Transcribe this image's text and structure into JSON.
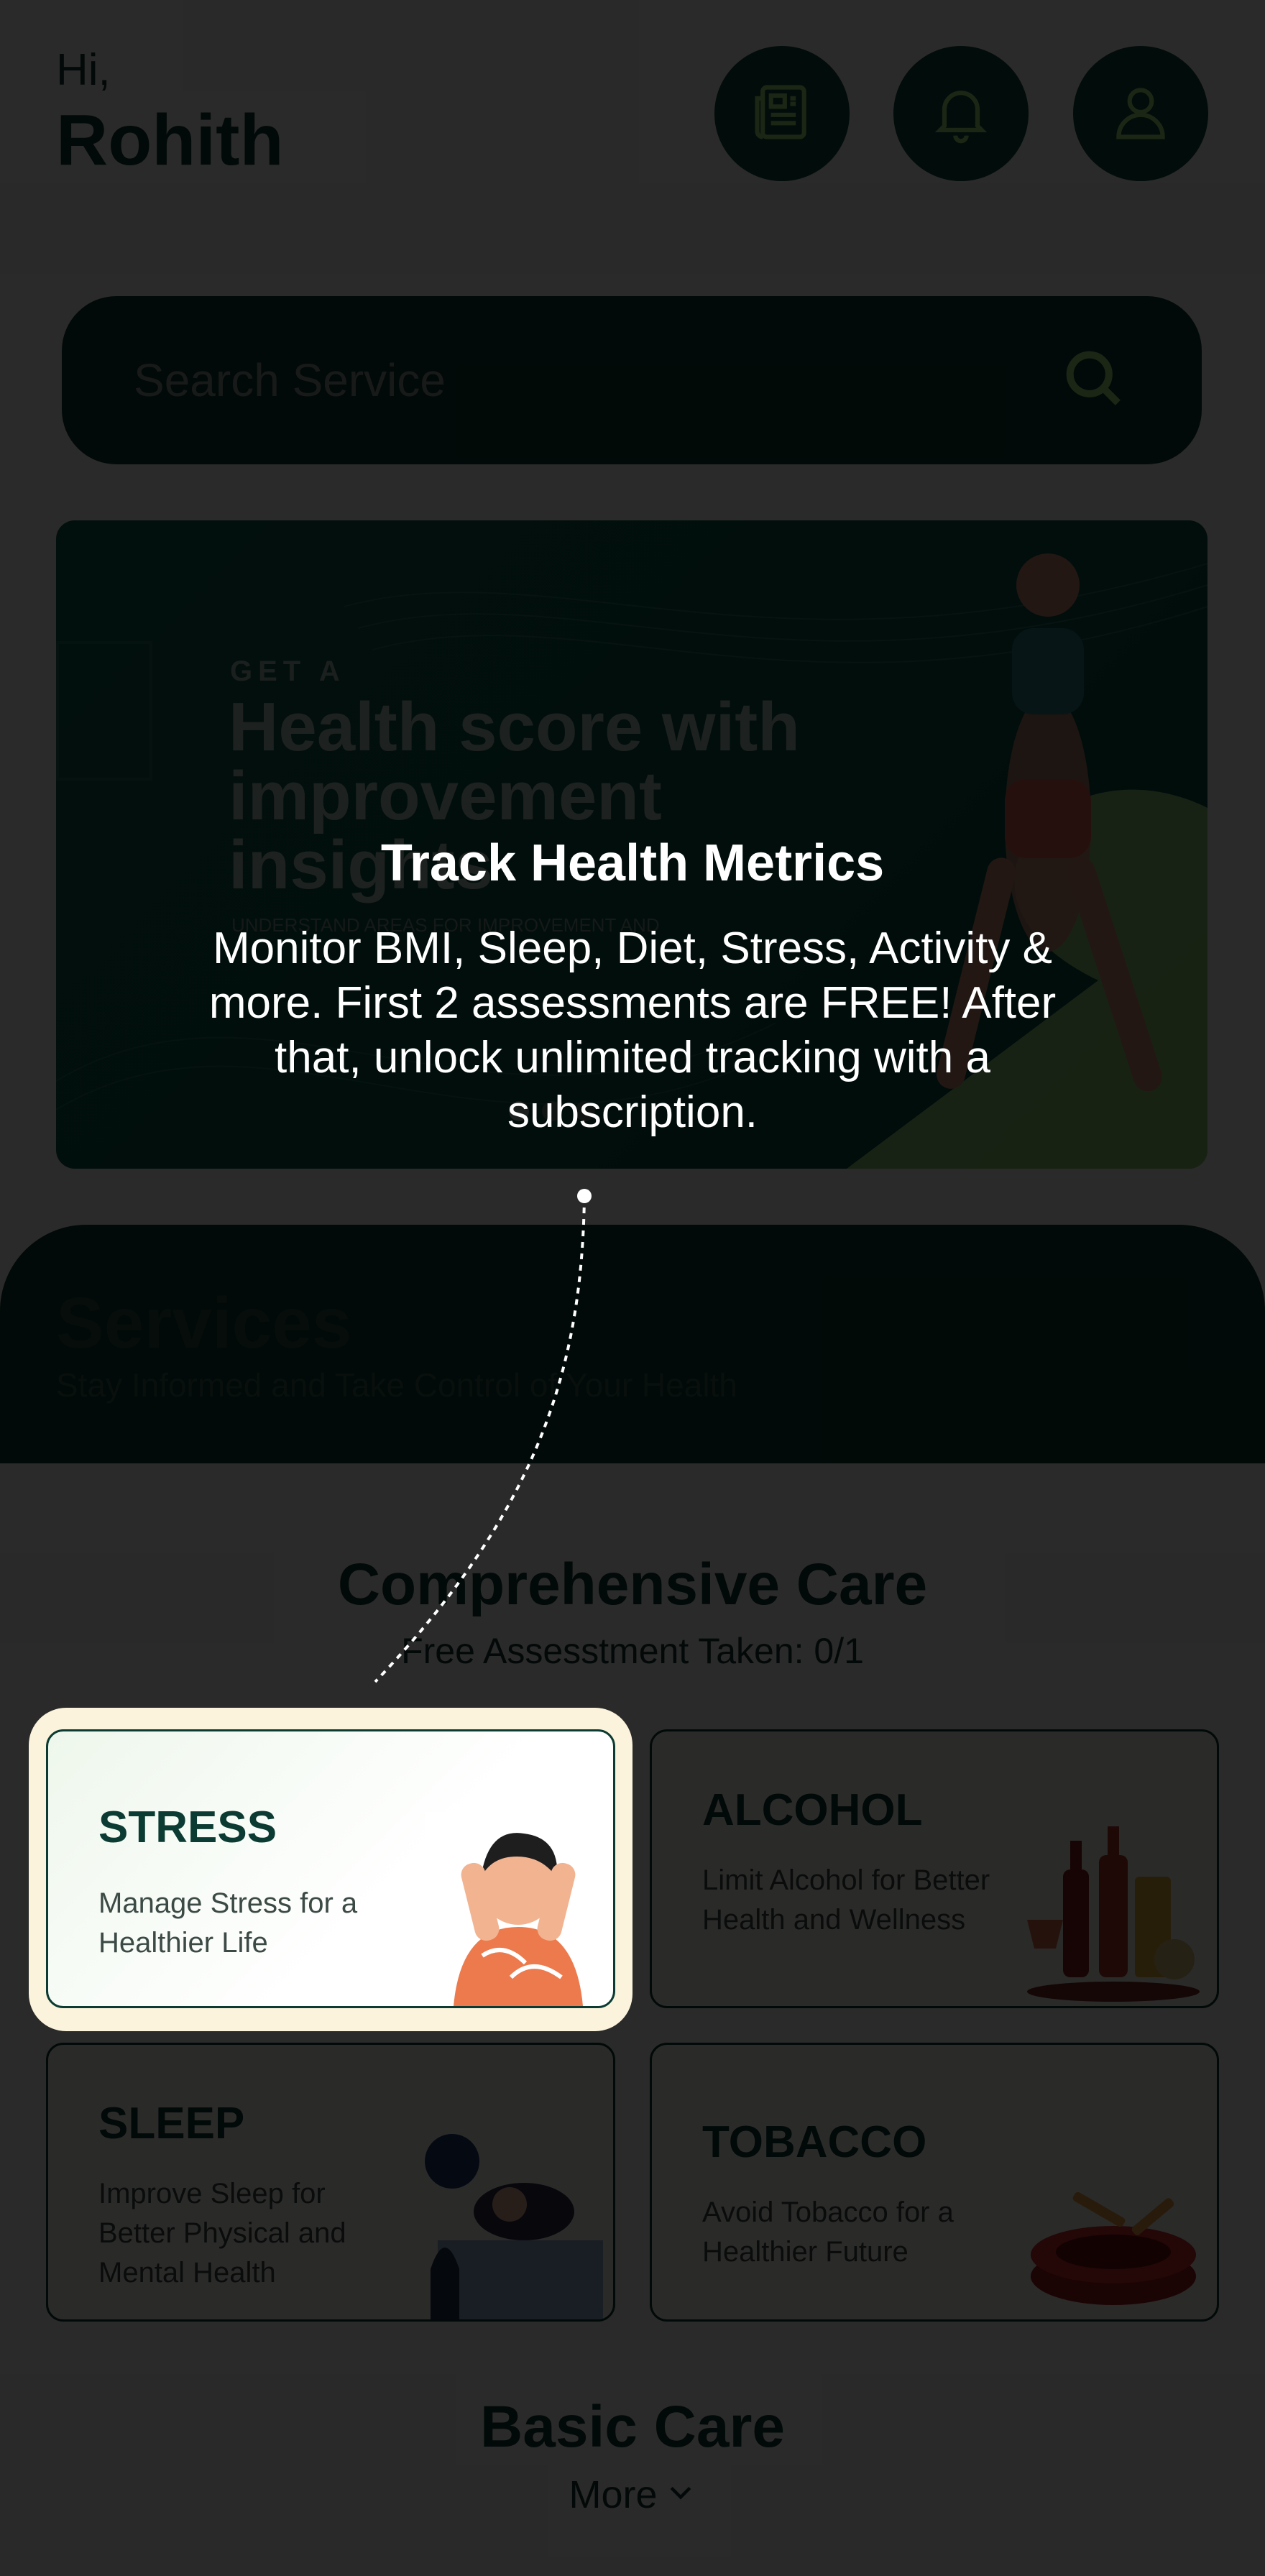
{
  "header": {
    "greeting": "Hi,",
    "user_name": "Rohith",
    "buttons": [
      "news-icon",
      "bell-icon",
      "profile-icon"
    ]
  },
  "search": {
    "placeholder": "Search Service"
  },
  "banner": {
    "small_text": "GET A",
    "headline": "Health score with improvement insights",
    "note": "UNDERSTAND AREAS FOR IMPROVEMENT AND"
  },
  "services": {
    "title": "Services",
    "subtitle": "Stay Informed and Take Control of Your Health"
  },
  "comprehensive": {
    "title": "Comprehensive Care",
    "assessment": "Free Assesstment Taken: 0/1",
    "cards": [
      {
        "title": "STRESS",
        "desc": "Manage Stress for a Healthier Life"
      },
      {
        "title": "ALCOHOL",
        "desc": "Limit Alcohol for Better Health and Wellness"
      },
      {
        "title": "SLEEP",
        "desc": "Improve Sleep for Better Physical and Mental Health"
      },
      {
        "title": "TOBACCO",
        "desc": "Avoid Tobacco for a Healthier Future"
      }
    ]
  },
  "basic": {
    "title": "Basic Care",
    "more_label": "More"
  },
  "coach": {
    "title": "Track Health Metrics",
    "body": "Monitor BMI, Sleep, Diet, Stress, Activity & more. First 2 assessments are FREE! After that, unlock unlimited tracking with a subscription."
  },
  "colors": {
    "primary": "#0b3b32",
    "highlight": "#fbf3dc",
    "accent_green": "#a6e07e"
  }
}
